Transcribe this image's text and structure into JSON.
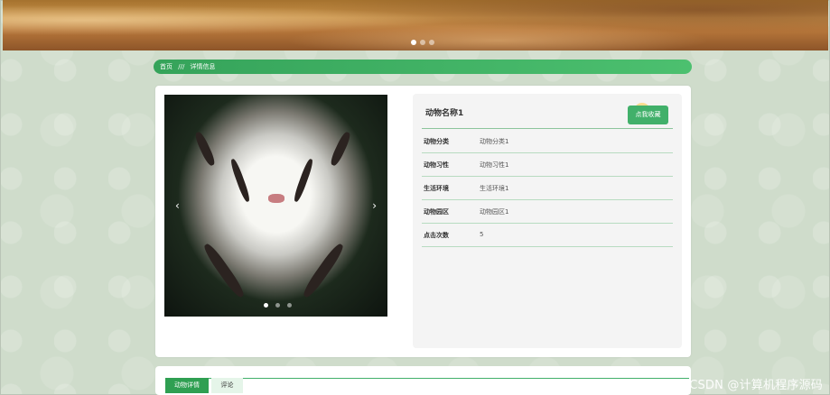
{
  "banner": {
    "slide_count": 3,
    "active_slide": 1
  },
  "breadcrumb": {
    "home": "首页",
    "separator": "///",
    "current": "详情信息"
  },
  "detail": {
    "name": "动物名称1",
    "favorite_label": "点我收藏",
    "fields": [
      {
        "label": "动物分类",
        "value": "动物分类1"
      },
      {
        "label": "动物习性",
        "value": "动物习性1"
      },
      {
        "label": "生活环境",
        "value": "生活环境1"
      },
      {
        "label": "动物园区",
        "value": "动物园区1"
      },
      {
        "label": "点击次数",
        "value": "5"
      }
    ],
    "image_slider": {
      "prev_icon": "‹",
      "next_icon": "›",
      "slide_count": 3,
      "active_slide": 1
    }
  },
  "tabs": [
    {
      "label": "动物详情",
      "active": true
    },
    {
      "label": "评论",
      "active": false
    }
  ],
  "watermark": "CSDN @计算机程序源码",
  "colors": {
    "primary_green": "#41b06a",
    "page_bg": "#cfdccb"
  }
}
